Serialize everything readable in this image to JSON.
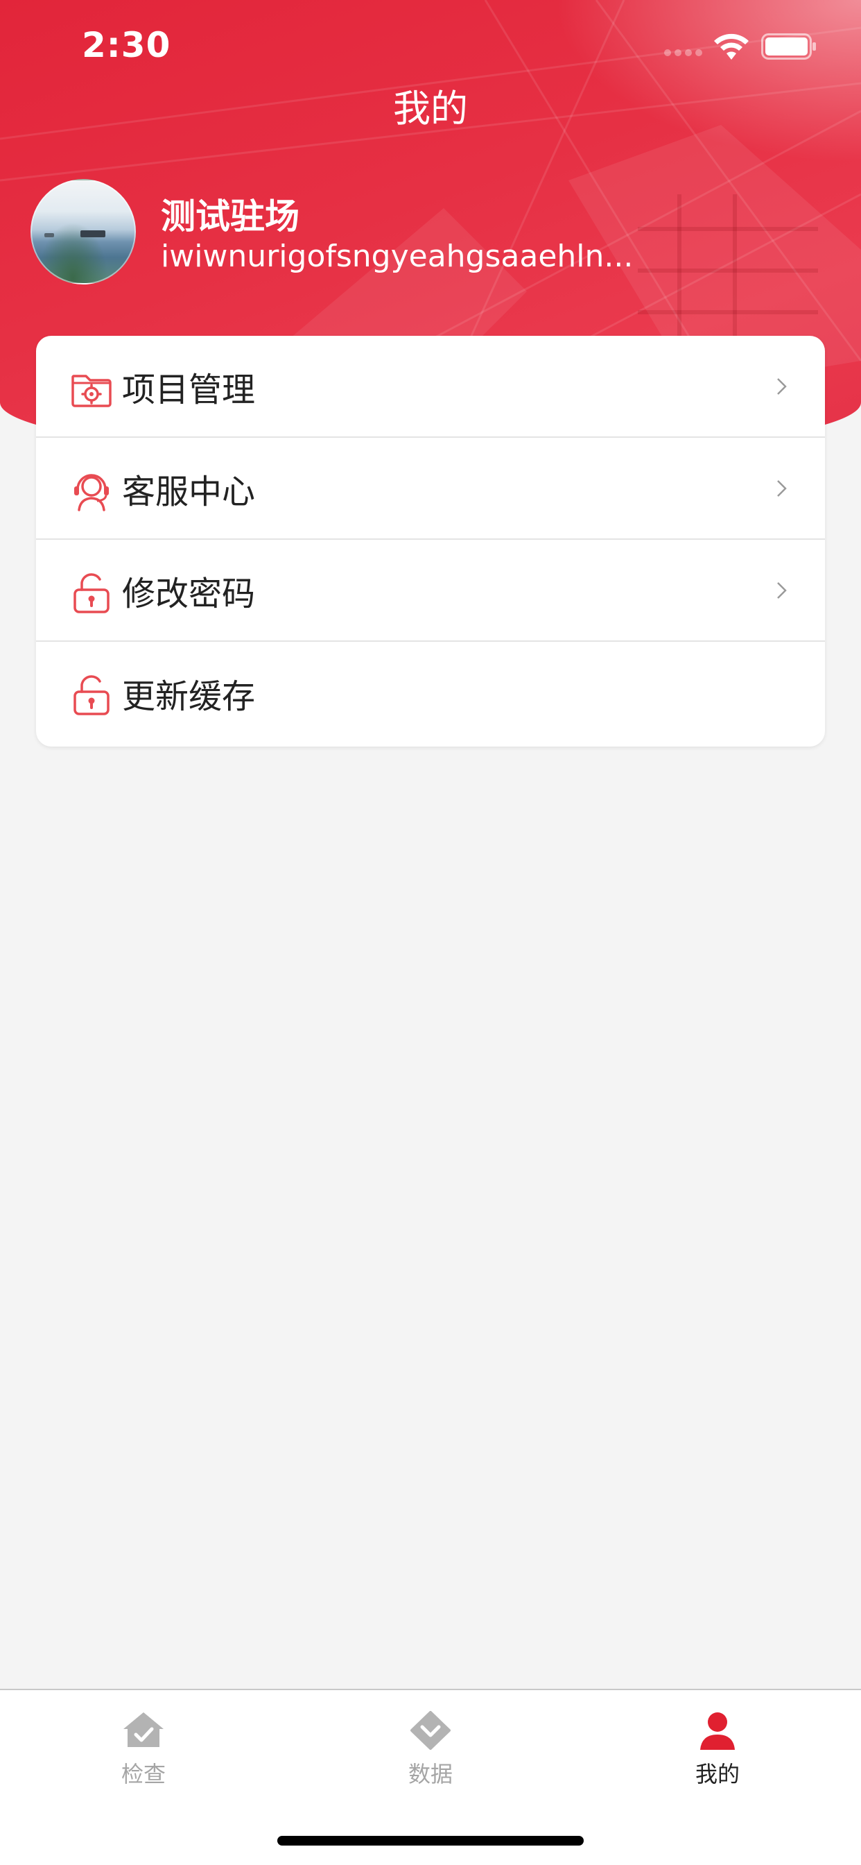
{
  "status_bar": {
    "time": "2:30"
  },
  "header": {
    "title": "我的"
  },
  "profile": {
    "name": "测试驻场",
    "subtitle": "iwiwnurigofsngyeahgsaaehln..."
  },
  "menu": {
    "items": [
      {
        "label": "项目管理",
        "icon": "folder-gear-icon",
        "has_chevron": true
      },
      {
        "label": "客服中心",
        "icon": "headset-agent-icon",
        "has_chevron": true
      },
      {
        "label": "修改密码",
        "icon": "unlock-icon",
        "has_chevron": true
      },
      {
        "label": "更新缓存",
        "icon": "unlock-icon",
        "has_chevron": false
      }
    ]
  },
  "tabbar": {
    "tabs": [
      {
        "label": "检查",
        "icon": "house-check-icon",
        "active": false
      },
      {
        "label": "数据",
        "icon": "diamond-chevron-icon",
        "active": false
      },
      {
        "label": "我的",
        "icon": "person-icon",
        "active": true
      }
    ]
  },
  "colors": {
    "accent": "#e8374a",
    "icon_stroke": "#e84b52",
    "tab_inactive": "#a5a5a5",
    "tab_active_icon": "#e02030"
  }
}
